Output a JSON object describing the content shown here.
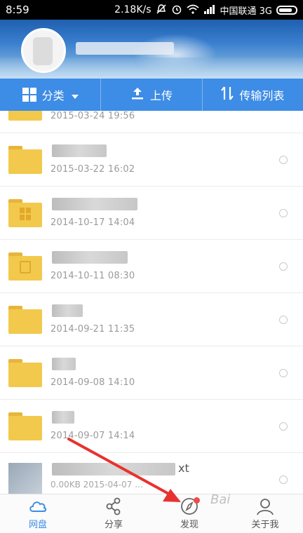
{
  "status_bar": {
    "time": "8:59",
    "speed": "2.18K/s",
    "carrier": "中国联通 3G"
  },
  "toolbar": {
    "category_label": "分类",
    "upload_label": "上传",
    "transfer_label": "传输列表"
  },
  "files": [
    {
      "timestamp": "2015-03-24  19:56"
    },
    {
      "timestamp": "2015-03-22  16:02"
    },
    {
      "timestamp": "2014-10-17  14:04"
    },
    {
      "timestamp": "2014-10-11  08:30"
    },
    {
      "timestamp": "2014-09-21  11:35"
    },
    {
      "timestamp": "2014-09-08  14:10"
    },
    {
      "timestamp": "2014-09-07  14:14"
    },
    {
      "timestamp": "0.00KB  2015-04-07  ...",
      "ext": "xt"
    }
  ],
  "bottom_nav": {
    "items": [
      {
        "label": "网盘",
        "icon": "cloud-icon"
      },
      {
        "label": "分享",
        "icon": "share-icon"
      },
      {
        "label": "发现",
        "icon": "compass-icon"
      },
      {
        "label": "关于我",
        "icon": "person-icon"
      }
    ],
    "watermark": "Bai"
  },
  "colors": {
    "accent": "#3d8ce6",
    "folder": "#f2c94c",
    "annotation_arrow": "#e8322f",
    "badge": "#f04a4a"
  }
}
